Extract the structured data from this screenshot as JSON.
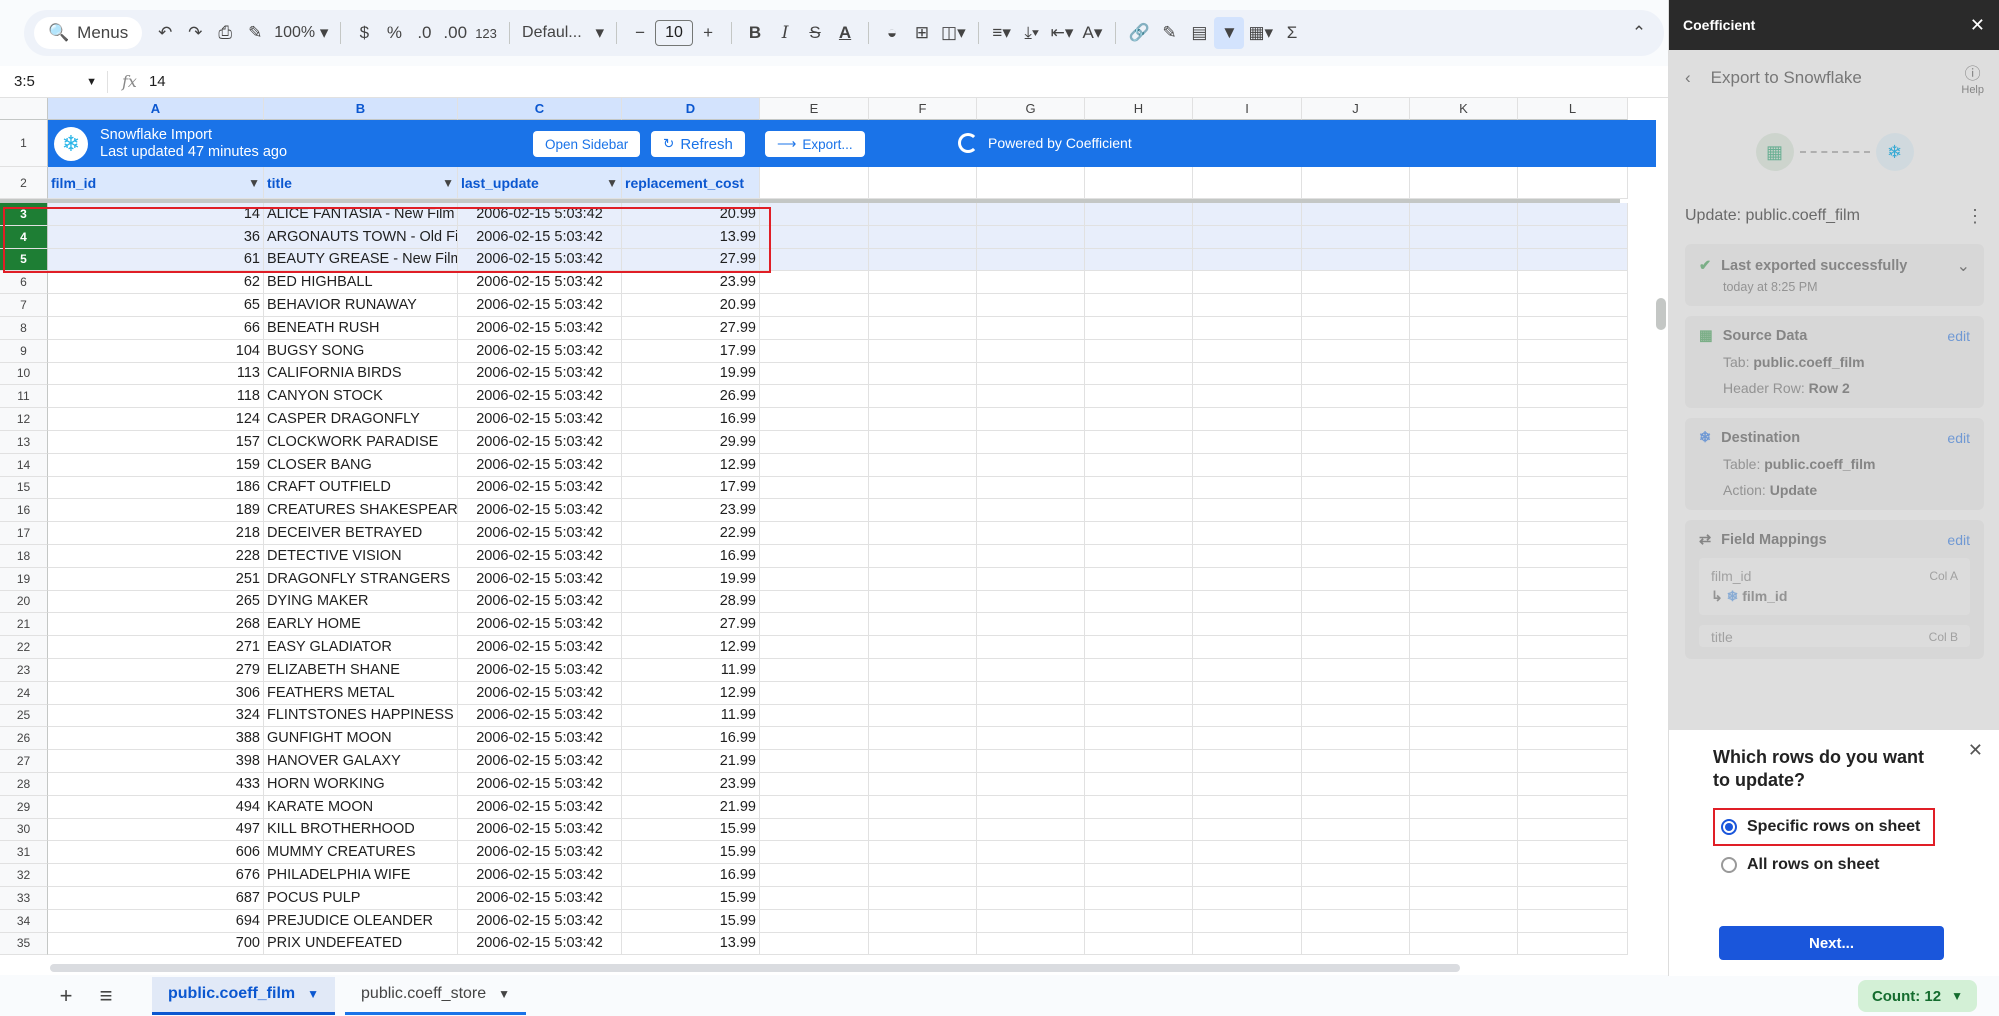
{
  "toolbar": {
    "menus_label": "Menus",
    "zoom": "100%",
    "currency": "$",
    "percent": "%",
    "dec_decrease": ".0",
    "dec_increase": ".00",
    "number_format": "123",
    "font": "Defaul...",
    "font_size": "10"
  },
  "formula_bar": {
    "namebox": "3:5",
    "fx": "fx",
    "value": "14"
  },
  "columns": [
    "A",
    "B",
    "C",
    "D",
    "E",
    "F",
    "G",
    "H",
    "I",
    "J",
    "K",
    "L"
  ],
  "banner": {
    "title": "Snowflake Import",
    "subtitle": "Last updated 47 minutes ago",
    "open_sidebar": "Open Sidebar",
    "refresh": "Refresh",
    "export": "Export...",
    "powered_by": "Powered by Coefficient"
  },
  "headers": [
    "film_id",
    "title",
    "last_update",
    "replacement_cost"
  ],
  "rows": [
    {
      "n": "3",
      "id": "14",
      "title": "ALICE FANTASIA - New Film :",
      "date": "2006-02-15 5:03:42",
      "cost": "20.99"
    },
    {
      "n": "4",
      "id": "36",
      "title": "ARGONAUTS TOWN - Old Fil",
      "date": "2006-02-15 5:03:42",
      "cost": "13.99"
    },
    {
      "n": "5",
      "id": "61",
      "title": "BEAUTY GREASE - New Film",
      "date": "2006-02-15 5:03:42",
      "cost": "27.99"
    },
    {
      "n": "6",
      "id": "62",
      "title": "BED HIGHBALL",
      "date": "2006-02-15 5:03:42",
      "cost": "23.99"
    },
    {
      "n": "7",
      "id": "65",
      "title": "BEHAVIOR RUNAWAY",
      "date": "2006-02-15 5:03:42",
      "cost": "20.99"
    },
    {
      "n": "8",
      "id": "66",
      "title": "BENEATH RUSH",
      "date": "2006-02-15 5:03:42",
      "cost": "27.99"
    },
    {
      "n": "9",
      "id": "104",
      "title": "BUGSY SONG",
      "date": "2006-02-15 5:03:42",
      "cost": "17.99"
    },
    {
      "n": "10",
      "id": "113",
      "title": "CALIFORNIA BIRDS",
      "date": "2006-02-15 5:03:42",
      "cost": "19.99"
    },
    {
      "n": "11",
      "id": "118",
      "title": "CANYON STOCK",
      "date": "2006-02-15 5:03:42",
      "cost": "26.99"
    },
    {
      "n": "12",
      "id": "124",
      "title": "CASPER DRAGONFLY",
      "date": "2006-02-15 5:03:42",
      "cost": "16.99"
    },
    {
      "n": "13",
      "id": "157",
      "title": "CLOCKWORK PARADISE",
      "date": "2006-02-15 5:03:42",
      "cost": "29.99"
    },
    {
      "n": "14",
      "id": "159",
      "title": "CLOSER BANG",
      "date": "2006-02-15 5:03:42",
      "cost": "12.99"
    },
    {
      "n": "15",
      "id": "186",
      "title": "CRAFT OUTFIELD",
      "date": "2006-02-15 5:03:42",
      "cost": "17.99"
    },
    {
      "n": "16",
      "id": "189",
      "title": "CREATURES SHAKESPEARI",
      "date": "2006-02-15 5:03:42",
      "cost": "23.99"
    },
    {
      "n": "17",
      "id": "218",
      "title": "DECEIVER BETRAYED",
      "date": "2006-02-15 5:03:42",
      "cost": "22.99"
    },
    {
      "n": "18",
      "id": "228",
      "title": "DETECTIVE VISION",
      "date": "2006-02-15 5:03:42",
      "cost": "16.99"
    },
    {
      "n": "19",
      "id": "251",
      "title": "DRAGONFLY STRANGERS",
      "date": "2006-02-15 5:03:42",
      "cost": "19.99"
    },
    {
      "n": "20",
      "id": "265",
      "title": "DYING MAKER",
      "date": "2006-02-15 5:03:42",
      "cost": "28.99"
    },
    {
      "n": "21",
      "id": "268",
      "title": "EARLY HOME",
      "date": "2006-02-15 5:03:42",
      "cost": "27.99"
    },
    {
      "n": "22",
      "id": "271",
      "title": "EASY GLADIATOR",
      "date": "2006-02-15 5:03:42",
      "cost": "12.99"
    },
    {
      "n": "23",
      "id": "279",
      "title": "ELIZABETH SHANE",
      "date": "2006-02-15 5:03:42",
      "cost": "11.99"
    },
    {
      "n": "24",
      "id": "306",
      "title": "FEATHERS METAL",
      "date": "2006-02-15 5:03:42",
      "cost": "12.99"
    },
    {
      "n": "25",
      "id": "324",
      "title": "FLINTSTONES HAPPINESS",
      "date": "2006-02-15 5:03:42",
      "cost": "11.99"
    },
    {
      "n": "26",
      "id": "388",
      "title": "GUNFIGHT MOON",
      "date": "2006-02-15 5:03:42",
      "cost": "16.99"
    },
    {
      "n": "27",
      "id": "398",
      "title": "HANOVER GALAXY",
      "date": "2006-02-15 5:03:42",
      "cost": "21.99"
    },
    {
      "n": "28",
      "id": "433",
      "title": "HORN WORKING",
      "date": "2006-02-15 5:03:42",
      "cost": "23.99"
    },
    {
      "n": "29",
      "id": "494",
      "title": "KARATE MOON",
      "date": "2006-02-15 5:03:42",
      "cost": "21.99"
    },
    {
      "n": "30",
      "id": "497",
      "title": "KILL BROTHERHOOD",
      "date": "2006-02-15 5:03:42",
      "cost": "15.99"
    },
    {
      "n": "31",
      "id": "606",
      "title": "MUMMY CREATURES",
      "date": "2006-02-15 5:03:42",
      "cost": "15.99"
    },
    {
      "n": "32",
      "id": "676",
      "title": "PHILADELPHIA WIFE",
      "date": "2006-02-15 5:03:42",
      "cost": "16.99"
    },
    {
      "n": "33",
      "id": "687",
      "title": "POCUS PULP",
      "date": "2006-02-15 5:03:42",
      "cost": "15.99"
    },
    {
      "n": "34",
      "id": "694",
      "title": "PREJUDICE OLEANDER",
      "date": "2006-02-15 5:03:42",
      "cost": "15.99"
    },
    {
      "n": "35",
      "id": "700",
      "title": "PRIX UNDEFEATED",
      "date": "2006-02-15 5:03:42",
      "cost": "13.99"
    }
  ],
  "sheet_tabs": {
    "active": "public.coeff_film",
    "other": "public.coeff_store",
    "count": "Count: 12"
  },
  "panel": {
    "app_name": "Coefficient",
    "nav_title": "Export to Snowflake",
    "help": "Help",
    "export_title": "Update: public.coeff_film",
    "status": "Last exported successfully",
    "status_time": "today at 8:25 PM",
    "source": {
      "heading": "Source Data",
      "edit": "edit",
      "tab_label": "Tab:",
      "tab_value": "public.coeff_film",
      "header_label": "Header Row:",
      "header_value": "Row 2"
    },
    "destination": {
      "heading": "Destination",
      "edit": "edit",
      "table_label": "Table:",
      "table_value": "public.coeff_film",
      "action_label": "Action:",
      "action_value": "Update"
    },
    "mappings": {
      "heading": "Field Mappings",
      "edit": "edit",
      "m1_from": "film_id",
      "m1_col": "Col A",
      "m1_to": "film_id",
      "m2_from": "title",
      "m2_col": "Col B"
    }
  },
  "modal": {
    "question": "Which rows do you want to update?",
    "option_specific": "Specific rows on sheet",
    "option_all": "All rows on sheet",
    "next": "Next..."
  },
  "colors": {
    "banner": "#1a73e8",
    "selected_row_header": "#1e7e34",
    "highlight": "#e01e26",
    "primary_button": "#1a56db"
  }
}
